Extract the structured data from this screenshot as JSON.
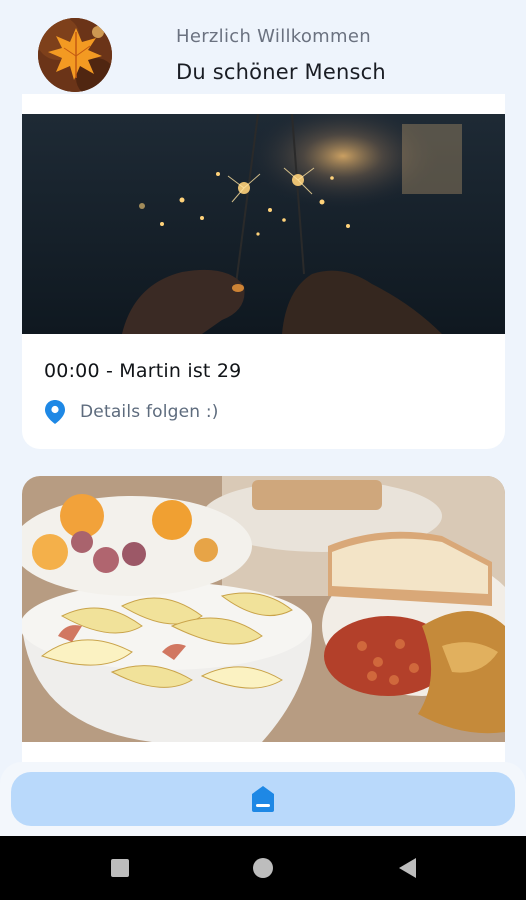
{
  "header": {
    "greeting": "Herzlich Willkommen",
    "username": "Du schöner Mensch",
    "avatar_icon": "autumn-leaf-avatar"
  },
  "events": [
    {
      "image": "sparklers-photo",
      "title": "00:00 - Martin ist 29",
      "location": "Details folgen :)",
      "location_icon": "location-pin-icon"
    },
    {
      "image": "breakfast-photo"
    }
  ],
  "bottom_nav": {
    "active_item": "home-icon",
    "background": "#b9d9fb",
    "accent": "#1e88e5"
  },
  "system_nav": {
    "buttons": [
      "recents-icon",
      "home-circle-icon",
      "back-icon"
    ]
  },
  "colors": {
    "page_background": "#eef4fc",
    "card_background": "#ffffff",
    "pin_color": "#1e88e5"
  }
}
